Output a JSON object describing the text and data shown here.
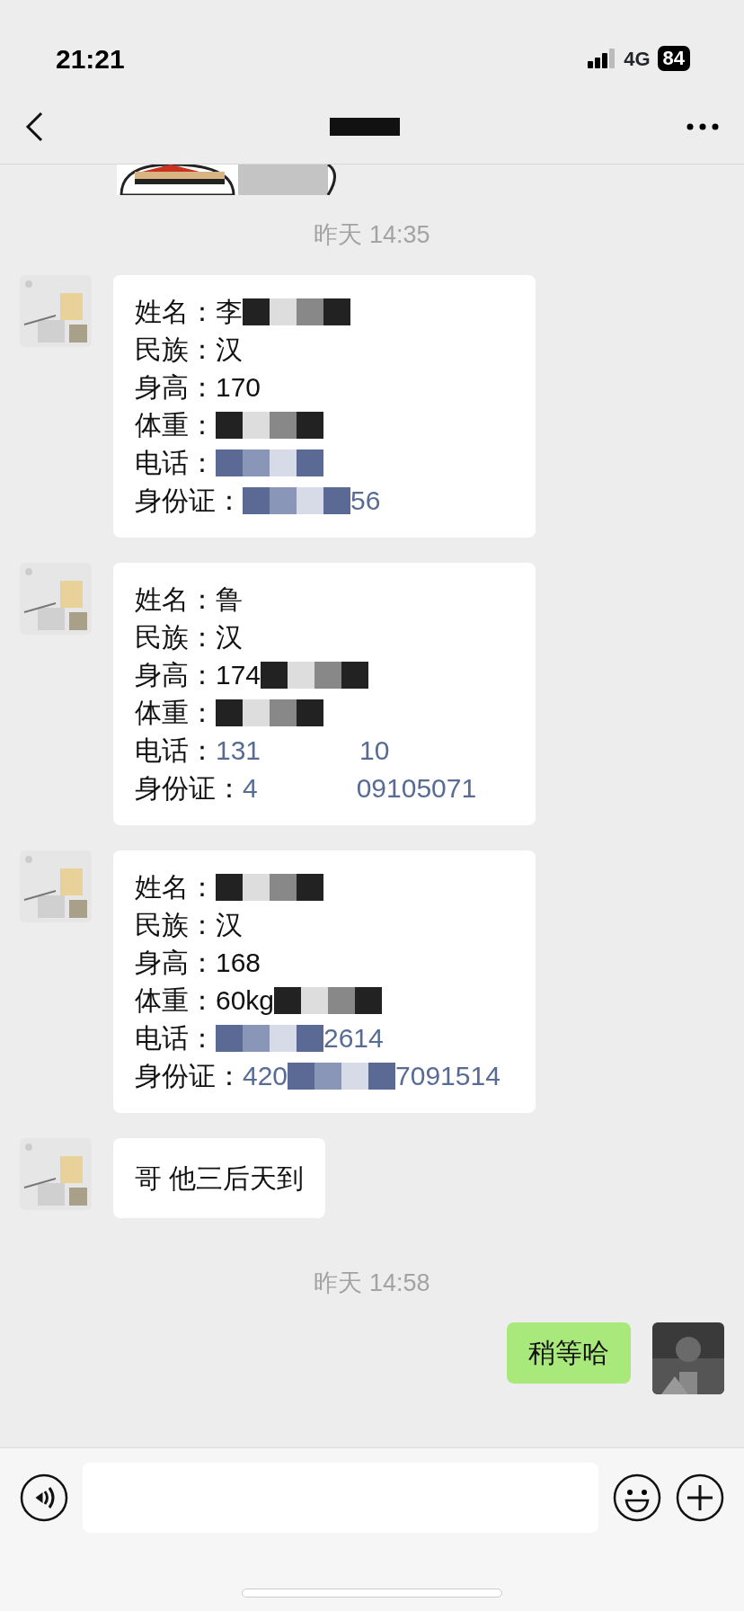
{
  "status_bar": {
    "time": "21:21",
    "network": "4G",
    "battery": "84"
  },
  "header": {
    "title_redacted": true
  },
  "messages": [
    {
      "kind": "sticker"
    },
    {
      "kind": "time",
      "text": "昨天 14:35"
    },
    {
      "kind": "card",
      "fields": [
        {
          "label": "姓名：",
          "start": "李",
          "redacted": true,
          "link": false
        },
        {
          "label": "民族：",
          "start": "汉",
          "redacted": false,
          "link": false
        },
        {
          "label": "身高：",
          "start": "170",
          "redacted": false,
          "link": false
        },
        {
          "label": "体重：",
          "redacted": true,
          "link": false
        },
        {
          "label": "电话：",
          "redacted": true,
          "link": true
        },
        {
          "label": "身份证：",
          "end": "56",
          "redacted": true,
          "link": true
        }
      ]
    },
    {
      "kind": "card",
      "fields": [
        {
          "label": "姓名：",
          "start": "鲁",
          "redacted": false,
          "link": false
        },
        {
          "label": "民族：",
          "start": "汉",
          "redacted": false,
          "link": false
        },
        {
          "label": "身高：",
          "start": "174",
          "redacted": true,
          "link": false
        },
        {
          "label": "体重：",
          "redacted": true,
          "link": false
        },
        {
          "label": "电话：",
          "start": "131",
          "end": "10",
          "redacted": false,
          "link": true
        },
        {
          "label": "身份证：",
          "start": "4",
          "end": "09105071",
          "redacted": false,
          "link": true
        }
      ]
    },
    {
      "kind": "card",
      "fields": [
        {
          "label": "姓名：",
          "redacted": true,
          "link": false
        },
        {
          "label": "民族：",
          "start": "汉",
          "redacted": false,
          "link": false
        },
        {
          "label": "身高：",
          "start": "168",
          "redacted": false,
          "link": false
        },
        {
          "label": "体重：",
          "start": "60kg",
          "redacted": true,
          "link": false
        },
        {
          "label": "电话：",
          "end": "2614",
          "redacted": true,
          "link": true
        },
        {
          "label": "身份证：",
          "start": "420",
          "end": "7091514",
          "redacted": true,
          "link": true
        }
      ]
    },
    {
      "kind": "text_in",
      "text": "哥 他三后天到"
    },
    {
      "kind": "time",
      "text": "昨天 14:58"
    },
    {
      "kind": "text_out",
      "text": "稍等哈"
    }
  ]
}
